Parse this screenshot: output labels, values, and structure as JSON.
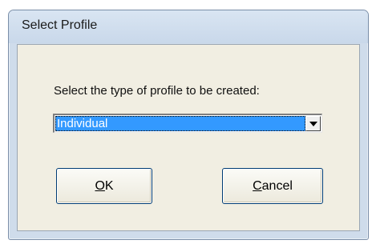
{
  "window": {
    "title": "Select Profile"
  },
  "dialog": {
    "prompt": "Select the type of profile to be created:",
    "profile_type": {
      "selected": "Individual"
    },
    "ok_button": {
      "mnemonic": "O",
      "rest": "K"
    },
    "cancel_button": {
      "mnemonic": "C",
      "rest": "ancel"
    }
  },
  "icons": {
    "dropdown": "chevron-down-icon"
  },
  "colors": {
    "selection": "#3399ff",
    "client_background": "#f1eee2",
    "frame": "#cfdceb"
  }
}
